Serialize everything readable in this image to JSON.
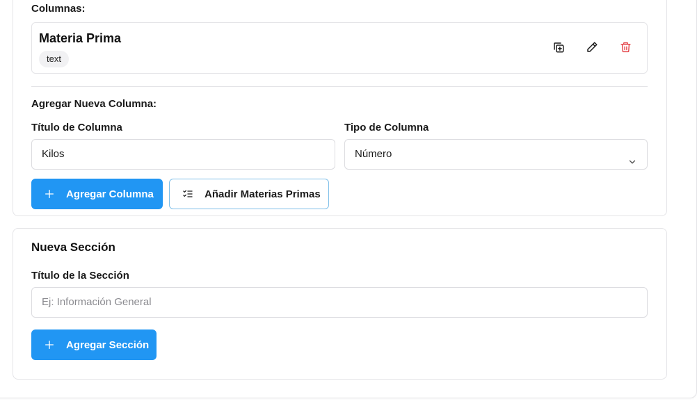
{
  "columns_section": {
    "label": "Columnas:",
    "items": [
      {
        "title": "Materia Prima",
        "type_badge": "text"
      }
    ]
  },
  "icons": {
    "duplicate": "duplicate-icon",
    "edit": "pencil-icon",
    "delete": "trash-icon",
    "plus": "plus-icon",
    "list_check": "list-check-icon",
    "chevron": "chevron-down-icon"
  },
  "colors": {
    "primary": "#2196f3",
    "danger": "#e5484d",
    "outline_border": "#7fbfe9"
  },
  "new_column": {
    "heading": "Agregar Nueva Columna:",
    "title_label": "Título de Columna",
    "title_value": "Kilos",
    "type_label": "Tipo de Columna",
    "type_value": "Número",
    "add_button": "Agregar Columna",
    "add_materials_button": "Añadir Materias Primas"
  },
  "new_section": {
    "heading": "Nueva Sección",
    "title_label": "Título de la Sección",
    "title_placeholder": "Ej: Información General",
    "add_button": "Agregar Sección"
  }
}
